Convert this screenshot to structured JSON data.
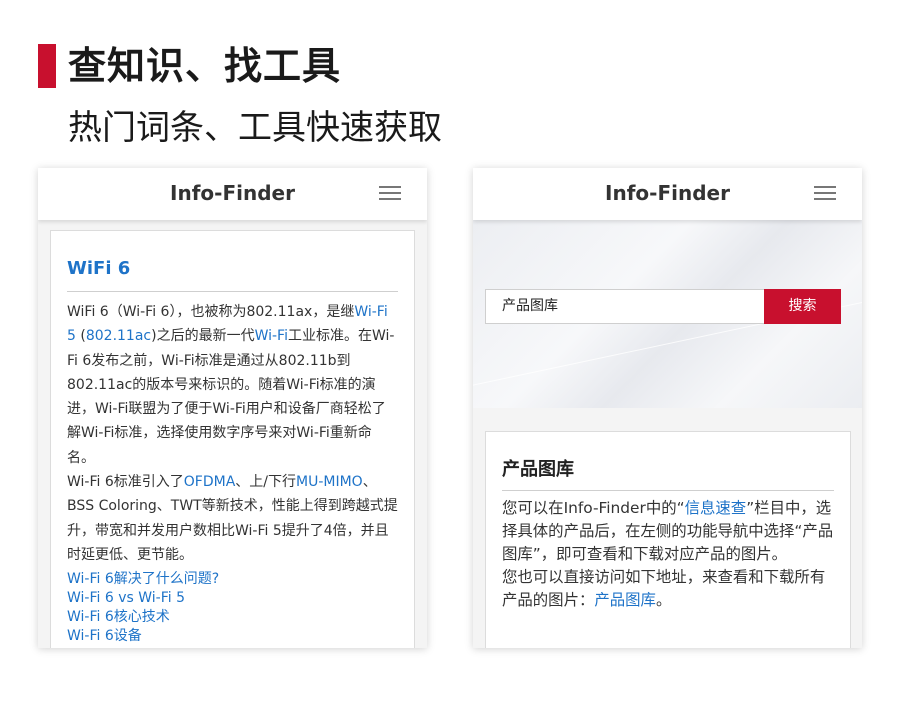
{
  "heading": {
    "title": "查知识、找工具",
    "subtitle": "热门词条、工具快速获取"
  },
  "colors": {
    "accent": "#c8102e",
    "link": "#1e73c8"
  },
  "left_phone": {
    "app_title": "Info-Finder",
    "menu_icon": "hamburger-menu-icon",
    "article": {
      "title": "WiFi 6",
      "p1_a": "WiFi 6（Wi-Fi 6），也被称为802.11ax，是继",
      "p1_link1": "Wi-Fi 5",
      "p1_b": " (",
      "p1_link2": "802.11ac",
      "p1_c": ")之后的最新一代",
      "p1_link3": "Wi-Fi",
      "p1_d": "工业标准。在Wi-Fi 6发布之前，Wi-Fi标准是通过从802.11b到802.11ac的版本号来标识的。随着Wi-Fi标准的演进，Wi-Fi联盟为了便于Wi-Fi用户和设备厂商轻松了解Wi-Fi标准，选择使用数字序号来对Wi-Fi重新命名。",
      "p2_a": "Wi-Fi 6标准引入了",
      "p2_link1": "OFDMA",
      "p2_b": "、上/下行",
      "p2_link2": "MU-MIMO",
      "p2_c": "、BSS Coloring、TWT等新技术，性能上得到跨越式提升，带宽和并发用户数相比Wi-Fi 5提升了4倍，并且时延更低、更节能。",
      "related_links": [
        "Wi-Fi 6解决了什么问题?",
        "Wi-Fi 6 vs Wi-Fi 5",
        "Wi-Fi 6核心技术",
        "Wi-Fi 6设备"
      ]
    }
  },
  "right_phone": {
    "app_title": "Info-Finder",
    "menu_icon": "hamburger-menu-icon",
    "search": {
      "value": "产品图库",
      "button_label": "搜索"
    },
    "card": {
      "title": "产品图库",
      "p1_a": "您可以在Info-Finder中的“",
      "p1_link": "信息速查",
      "p1_b": "”栏目中，选择具体的产品后，在左侧的功能导航中选择“产品图库”，即可查看和下载对应产品的图片。",
      "p2_a": "您也可以直接访问如下地址，来查看和下载所有产品的图片：",
      "p2_link": "产品图库",
      "p2_b": "。"
    }
  }
}
